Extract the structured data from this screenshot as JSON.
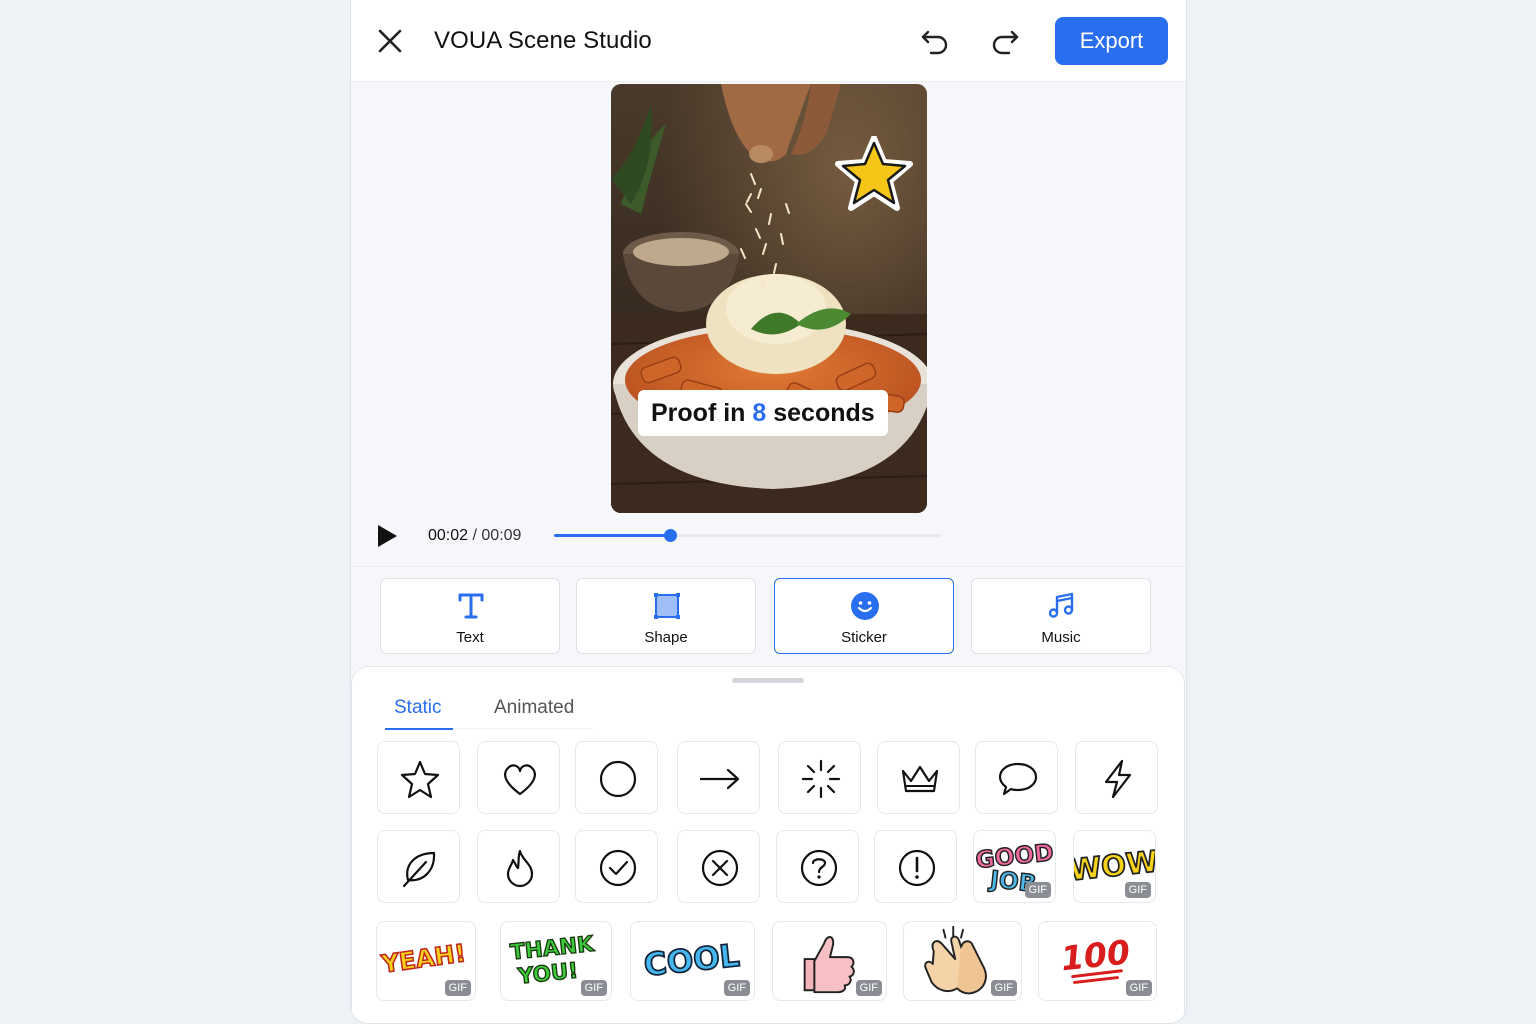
{
  "header": {
    "title": "VOUA Scene Studio",
    "export_label": "Export"
  },
  "preview": {
    "caption_before": "Proof in ",
    "caption_highlight": "8",
    "caption_after": " seconds"
  },
  "playback": {
    "current_time": "00:02",
    "separator": " / ",
    "total_time": "00:09",
    "progress": 0.3
  },
  "tools": [
    {
      "label": "Text",
      "icon": "text-icon"
    },
    {
      "label": "Shape",
      "icon": "shape-icon"
    },
    {
      "label": "Sticker",
      "icon": "sticker-icon",
      "active": true
    },
    {
      "label": "Music",
      "icon": "music-icon"
    }
  ],
  "panel": {
    "tabs": [
      {
        "label": "Static",
        "active": true
      },
      {
        "label": "Animated",
        "active": false
      }
    ],
    "row1_icons": [
      "star-icon",
      "heart-icon",
      "circle-icon",
      "arrow-right-icon",
      "burst-icon",
      "crown-icon",
      "speech-bubble-icon",
      "lightning-icon"
    ],
    "row2_icons": [
      "leaf-icon",
      "flame-icon",
      "check-circle-icon",
      "x-circle-icon",
      "question-circle-icon",
      "exclamation-circle-icon"
    ],
    "row2_gifs": [
      {
        "name": "good-job-sticker",
        "text_1": "GOOD",
        "text_2": "JOB",
        "badge": "GIF"
      },
      {
        "name": "wow-sticker",
        "text_1": "WOW",
        "badge": "GIF"
      }
    ],
    "row3_gifs": [
      {
        "name": "yeah-sticker",
        "text_1": "YEAH!",
        "badge": "GIF"
      },
      {
        "name": "thank-you-sticker",
        "text_1": "THANK",
        "text_2": "YOU!",
        "badge": "GIF"
      },
      {
        "name": "cool-sticker",
        "text_1": "COOL",
        "badge": "GIF"
      },
      {
        "name": "thumbs-up-sticker",
        "badge": "GIF"
      },
      {
        "name": "clapping-hands-sticker",
        "badge": "GIF"
      },
      {
        "name": "hundred-sticker",
        "text_1": "100",
        "badge": "GIF"
      }
    ]
  },
  "colors": {
    "accent": "#2a6ef0",
    "background": "#eef1f6"
  }
}
